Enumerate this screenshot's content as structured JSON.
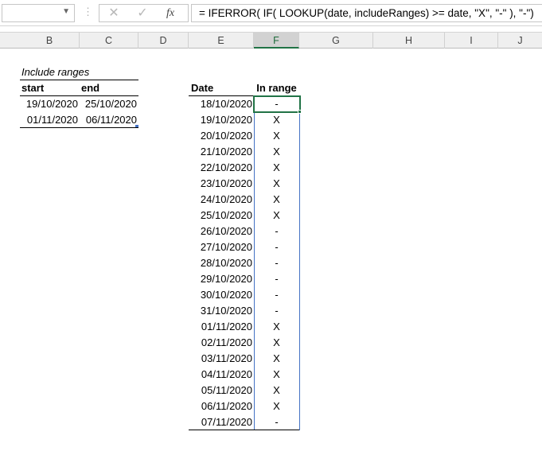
{
  "formula_bar": {
    "name_box": "",
    "cancel_glyph": "✕",
    "enter_glyph": "✓",
    "fx_glyph": "fx",
    "formula": "= IFERROR( IF( LOOKUP(date, includeRanges) >= date, \"X\", \"-\" ), \"-\")"
  },
  "columns": [
    "B",
    "C",
    "D",
    "E",
    "F",
    "G",
    "H",
    "I",
    "J"
  ],
  "selected_column": "F",
  "include_ranges": {
    "title": "Include ranges",
    "headers": [
      "start",
      "end"
    ],
    "rows": [
      [
        "19/10/2020",
        "25/10/2020"
      ],
      [
        "01/11/2020",
        "06/11/2020"
      ]
    ]
  },
  "results": {
    "headers": [
      "Date",
      "In range"
    ],
    "rows": [
      [
        "18/10/2020",
        "-"
      ],
      [
        "19/10/2020",
        "X"
      ],
      [
        "20/10/2020",
        "X"
      ],
      [
        "21/10/2020",
        "X"
      ],
      [
        "22/10/2020",
        "X"
      ],
      [
        "23/10/2020",
        "X"
      ],
      [
        "24/10/2020",
        "X"
      ],
      [
        "25/10/2020",
        "X"
      ],
      [
        "26/10/2020",
        "-"
      ],
      [
        "27/10/2020",
        "-"
      ],
      [
        "28/10/2020",
        "-"
      ],
      [
        "29/10/2020",
        "-"
      ],
      [
        "30/10/2020",
        "-"
      ],
      [
        "31/10/2020",
        "-"
      ],
      [
        "01/11/2020",
        "X"
      ],
      [
        "02/11/2020",
        "X"
      ],
      [
        "03/11/2020",
        "X"
      ],
      [
        "04/11/2020",
        "X"
      ],
      [
        "05/11/2020",
        "X"
      ],
      [
        "06/11/2020",
        "X"
      ],
      [
        "07/11/2020",
        "-"
      ]
    ]
  },
  "colors": {
    "selection": "#217346",
    "range_highlight": "#4472c4"
  }
}
